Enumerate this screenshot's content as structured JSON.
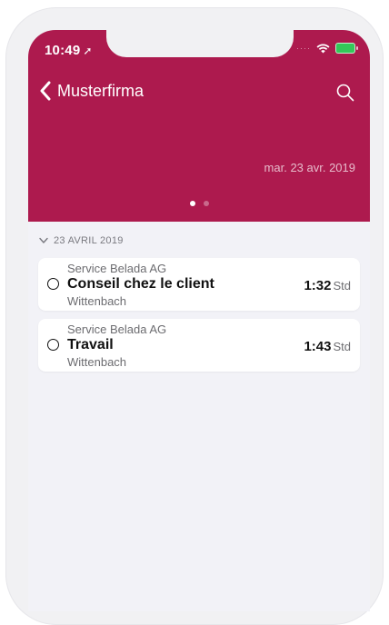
{
  "status_bar": {
    "time": "10:49"
  },
  "nav": {
    "back_label": "Musterfirma"
  },
  "header": {
    "date": "mar. 23 avr. 2019"
  },
  "section": {
    "title": "23 AVRIL 2019"
  },
  "entries": [
    {
      "company": "Service Belada AG",
      "title": "Conseil chez le client",
      "place": "Wittenbach",
      "duration": "1:32",
      "unit": "Std"
    },
    {
      "company": "Service Belada AG",
      "title": "Travail",
      "place": "Wittenbach",
      "duration": "1:43",
      "unit": "Std"
    }
  ],
  "colors": {
    "accent": "#ad1a4e",
    "background": "#f2f2f7"
  },
  "icons": {
    "back": "chevron-left-icon",
    "search": "search-icon",
    "location": "location-arrow-icon",
    "wifi": "wifi-icon",
    "battery": "battery-icon"
  }
}
